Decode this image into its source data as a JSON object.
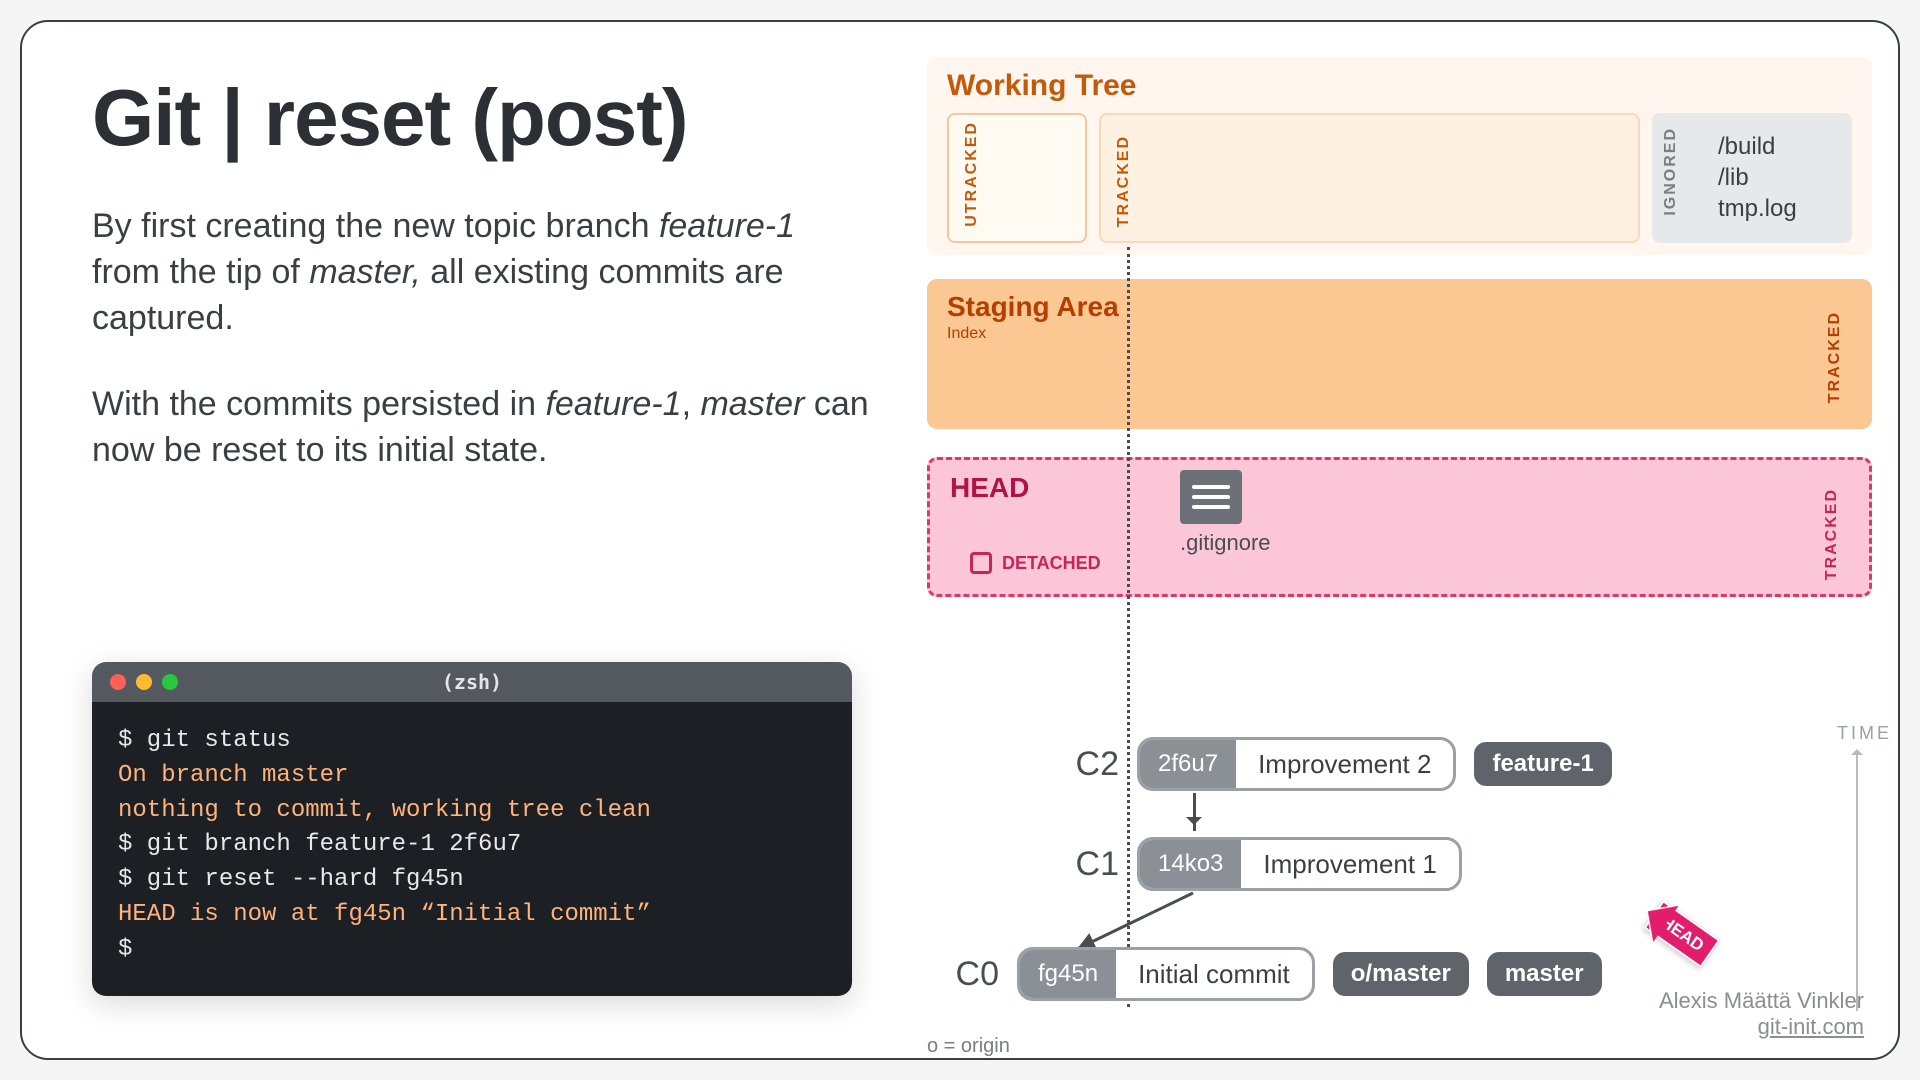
{
  "title": "Git | reset (post)",
  "paragraphs": [
    "By first creating the new topic branch <em>feature-1</em> from the tip of <em>master,</em> all existing commits are captured.",
    "With the commits persisted in <em>feature-1</em>, <em>master</em> can now be reset to its initial state."
  ],
  "terminal": {
    "shell": "(zsh)",
    "lines": [
      {
        "cls": "w",
        "text": "$ git status"
      },
      {
        "cls": "o",
        "text": "On branch master"
      },
      {
        "cls": "o",
        "text": "nothing to commit, working tree clean"
      },
      {
        "cls": "w",
        "text": "$ git branch feature-1 2f6u7"
      },
      {
        "cls": "w",
        "text": "$ git reset --hard fg45n"
      },
      {
        "cls": "o",
        "text": "HEAD is now at fg45n “Initial commit”"
      },
      {
        "cls": "w",
        "text": "$ "
      }
    ]
  },
  "panels": {
    "working_tree": "Working Tree",
    "utracked": "UTRACKED",
    "tracked": "TRACKED",
    "ignored": "IGNORED",
    "ignored_files": [
      "/build",
      "/lib",
      "tmp.log"
    ],
    "staging_title": "Staging Area",
    "staging_sub": "Index",
    "head_title": "HEAD",
    "detached": "DETACHED",
    "gitignore": ".gitignore"
  },
  "commits": [
    {
      "id": "C2",
      "hash": "2f6u7",
      "msg": "Improvement 2",
      "tags": [
        "feature-1"
      ]
    },
    {
      "id": "C1",
      "hash": "14ko3",
      "msg": "Improvement 1",
      "tags": []
    },
    {
      "id": "C0",
      "hash": "fg45n",
      "msg": "Initial commit",
      "tags": [
        "o/master",
        "master"
      ]
    }
  ],
  "head_pointer": "HEAD",
  "time_label": "TIME",
  "legend": "o = origin",
  "credit_name": "Alexis Määttä Vinkler",
  "credit_site": "git-init.com"
}
